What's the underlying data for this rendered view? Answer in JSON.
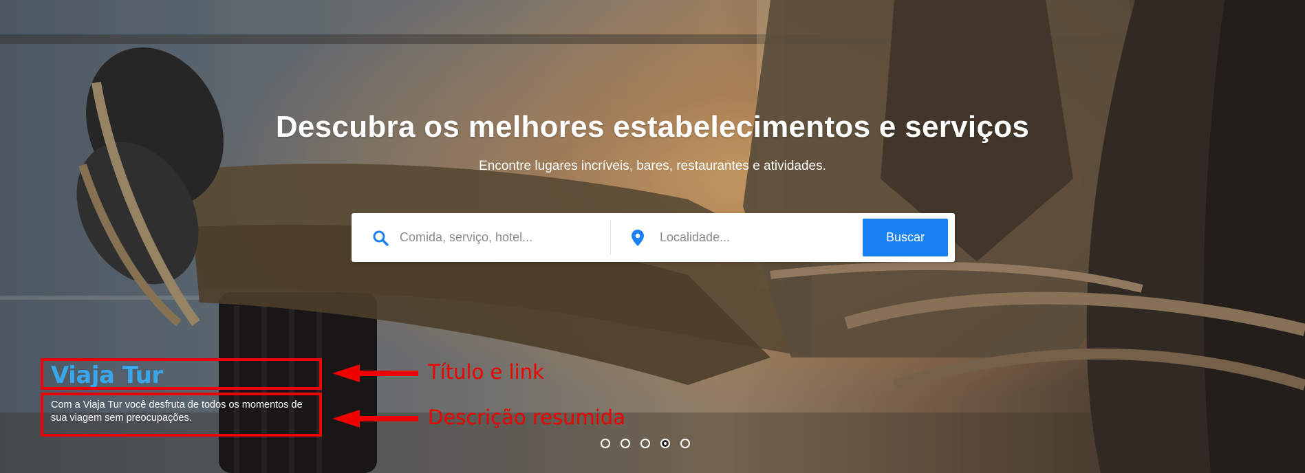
{
  "hero": {
    "title": "Descubra os melhores estabelecimentos e serviços",
    "subtitle": "Encontre lugares incríveis, bares, restaurantes e atividades."
  },
  "search": {
    "what_placeholder": "Comida, serviço, hotel...",
    "what_icon": "search-icon",
    "where_placeholder": "Localidade...",
    "where_icon": "map-pin-icon",
    "button_label": "Buscar",
    "accent_color": "#1a82f5"
  },
  "slide_caption": {
    "title": "Viaja Tur",
    "description": "Com a Viaja Tur você desfruta de todos os momentos de sua viagem sem preocupações."
  },
  "annotations": {
    "title_label": "Título e link",
    "description_label": "Descrição resumida",
    "color": "#ef0000"
  },
  "carousel": {
    "slide_count": 5,
    "active_index": 3
  }
}
